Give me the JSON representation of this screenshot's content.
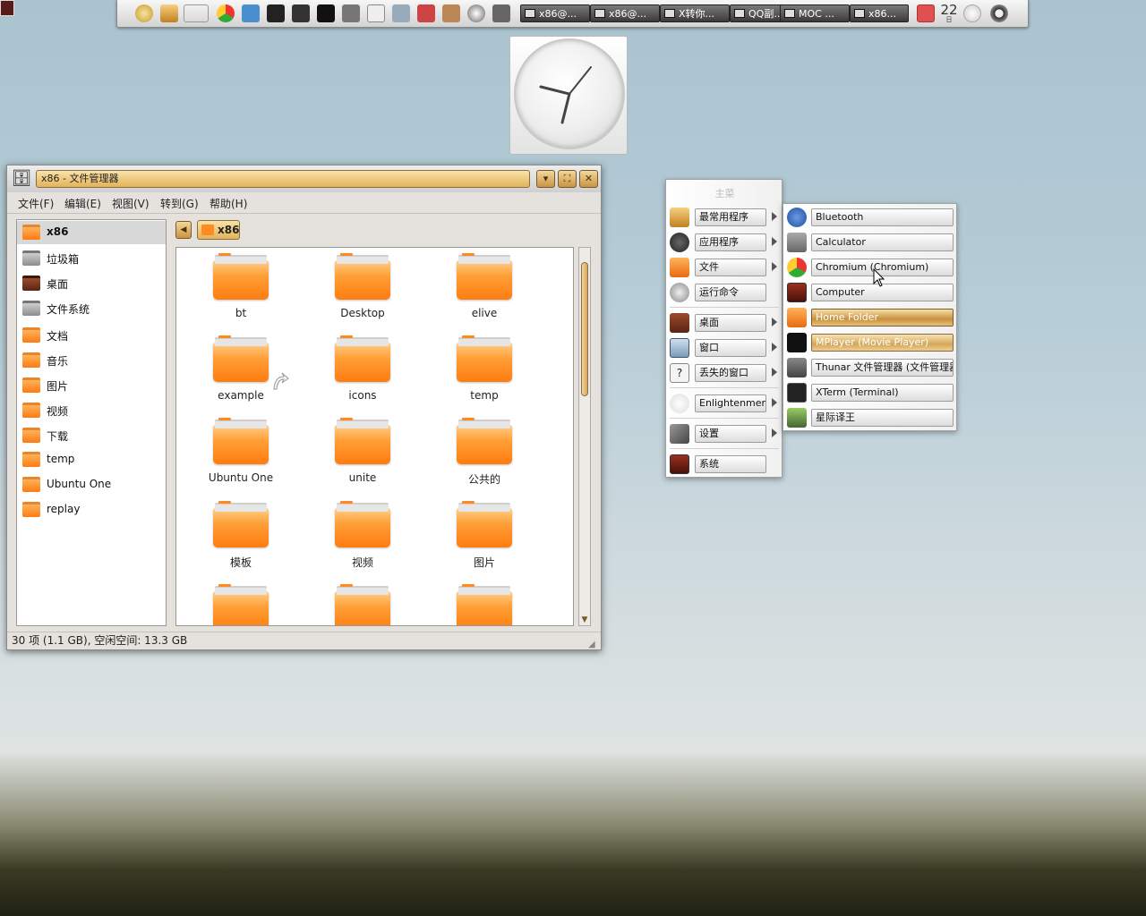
{
  "shelf": {
    "tasks": [
      "x86@...",
      "x86@...",
      "X转你...",
      "QQ副...",
      "MOC ...",
      "x86..."
    ],
    "calendar_day": "22",
    "calendar_unit": "日"
  },
  "file_manager": {
    "title": "x86 - 文件管理器",
    "menu": [
      "文件(F)",
      "编辑(E)",
      "视图(V)",
      "转到(G)",
      "帮助(H)"
    ],
    "sidebar": [
      {
        "label": "x86",
        "icon": "home-folder-icon"
      },
      {
        "label": "垃圾箱",
        "icon": "trash-icon"
      },
      {
        "label": "桌面",
        "icon": "desktop-icon"
      },
      {
        "label": "文件系统",
        "icon": "drive-icon"
      },
      {
        "label": "文档",
        "icon": "folder-icon"
      },
      {
        "label": "音乐",
        "icon": "folder-icon"
      },
      {
        "label": "图片",
        "icon": "folder-icon"
      },
      {
        "label": "视频",
        "icon": "folder-icon"
      },
      {
        "label": "下载",
        "icon": "folder-icon"
      },
      {
        "label": "temp",
        "icon": "folder-icon"
      },
      {
        "label": "Ubuntu One",
        "icon": "folder-icon"
      },
      {
        "label": "replay",
        "icon": "folder-icon"
      }
    ],
    "selected_sidebar": "x86",
    "path": "x86",
    "folders": [
      "bt",
      "Desktop",
      "elive",
      "example",
      "icons",
      "temp",
      "Ubuntu One",
      "unite",
      "公共的",
      "模板",
      "视频",
      "图片",
      "",
      "",
      ""
    ],
    "status": "30 项 (1.1 GB), 空闲空间: 13.3 GB"
  },
  "main_menu": {
    "title": "主菜",
    "items": [
      {
        "label": "最常用程序",
        "icon": "bookmark-icon",
        "submenu": true
      },
      {
        "label": "应用程序",
        "icon": "play-icon",
        "submenu": true
      },
      {
        "label": "文件",
        "icon": "files-icon",
        "submenu": true
      },
      {
        "label": "运行命令",
        "icon": "gears-icon",
        "submenu": false
      },
      {
        "label": "桌面",
        "icon": "mixer-icon",
        "submenu": true
      },
      {
        "label": "窗口",
        "icon": "windows-icon",
        "submenu": true
      },
      {
        "label": "丢失的窗口",
        "icon": "question-icon",
        "submenu": true
      },
      {
        "label": "Enlightenment",
        "icon": "enlightenment-icon",
        "submenu": true
      },
      {
        "label": "设置",
        "icon": "tools-icon",
        "submenu": true
      },
      {
        "label": "系统",
        "icon": "computer-icon",
        "submenu": false
      }
    ]
  },
  "submenu": {
    "items": [
      {
        "label": "Bluetooth",
        "icon": "bluetooth-icon"
      },
      {
        "label": "Calculator",
        "icon": "calculator-icon"
      },
      {
        "label": "Chromium (Chromium)",
        "icon": "chromium-icon"
      },
      {
        "label": "Computer",
        "icon": "computer-icon"
      },
      {
        "label": "Home Folder",
        "icon": "home-folder-icon"
      },
      {
        "label": "MPlayer (Movie Player)",
        "icon": "mplayer-icon"
      },
      {
        "label": "Thunar 文件管理器 (文件管理器)",
        "icon": "thunar-icon"
      },
      {
        "label": "XTerm (Terminal)",
        "icon": "terminal-icon"
      },
      {
        "label": "星际译王",
        "icon": "dictionary-icon"
      }
    ]
  }
}
